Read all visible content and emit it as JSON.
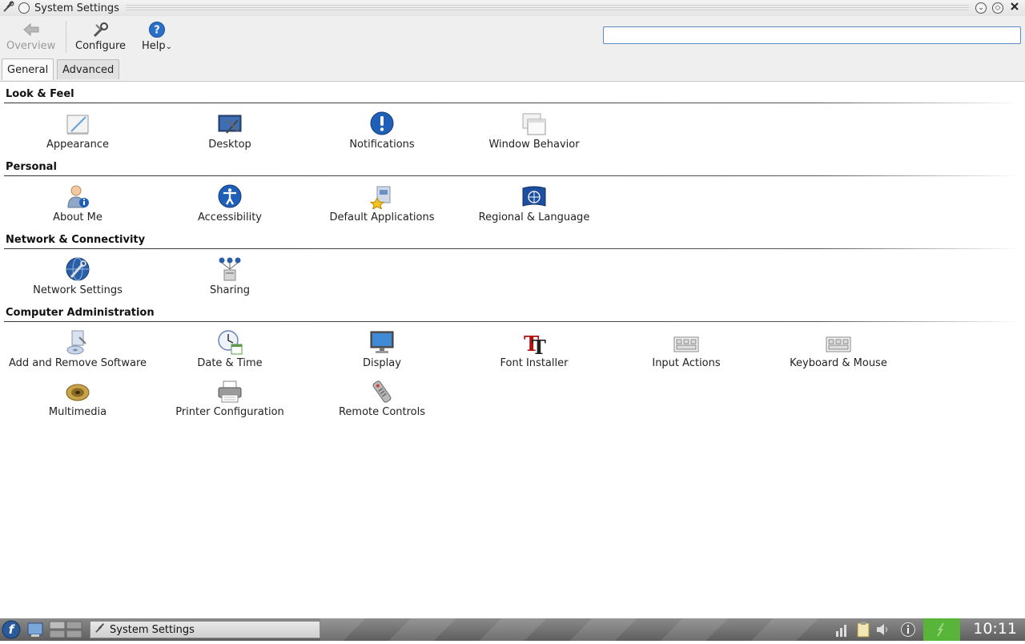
{
  "window": {
    "title": "System Settings"
  },
  "toolbar": {
    "overview_label": "Overview",
    "configure_label": "Configure",
    "help_label": "Help",
    "search_value": ""
  },
  "tabs": [
    {
      "label": "General",
      "active": true
    },
    {
      "label": "Advanced",
      "active": false
    }
  ],
  "sections": [
    {
      "title": "Look & Feel",
      "items": [
        {
          "label": "Appearance",
          "icon": "appearance-icon"
        },
        {
          "label": "Desktop",
          "icon": "desktop-icon"
        },
        {
          "label": "Notifications",
          "icon": "notifications-icon"
        },
        {
          "label": "Window Behavior",
          "icon": "window-behavior-icon"
        }
      ]
    },
    {
      "title": "Personal",
      "items": [
        {
          "label": "About Me",
          "icon": "about-me-icon"
        },
        {
          "label": "Accessibility",
          "icon": "accessibility-icon"
        },
        {
          "label": "Default Applications",
          "icon": "default-applications-icon"
        },
        {
          "label": "Regional & Language",
          "icon": "regional-language-icon"
        }
      ]
    },
    {
      "title": "Network & Connectivity",
      "items": [
        {
          "label": "Network Settings",
          "icon": "network-settings-icon"
        },
        {
          "label": "Sharing",
          "icon": "sharing-icon"
        }
      ]
    },
    {
      "title": "Computer Administration",
      "items": [
        {
          "label": "Add and Remove Software",
          "icon": "software-icon"
        },
        {
          "label": "Date & Time",
          "icon": "date-time-icon"
        },
        {
          "label": "Display",
          "icon": "display-icon"
        },
        {
          "label": "Font Installer",
          "icon": "font-installer-icon"
        },
        {
          "label": "Input Actions",
          "icon": "input-actions-icon"
        },
        {
          "label": "Keyboard & Mouse",
          "icon": "keyboard-mouse-icon"
        },
        {
          "label": "Multimedia",
          "icon": "multimedia-icon"
        },
        {
          "label": "Printer Configuration",
          "icon": "printer-icon"
        },
        {
          "label": "Remote Controls",
          "icon": "remote-controls-icon"
        }
      ]
    }
  ],
  "taskbar": {
    "task_label": "System Settings",
    "clock": "10:11"
  },
  "colors": {
    "accent": "#5a8dc7",
    "tray_green": "#59b43a"
  }
}
